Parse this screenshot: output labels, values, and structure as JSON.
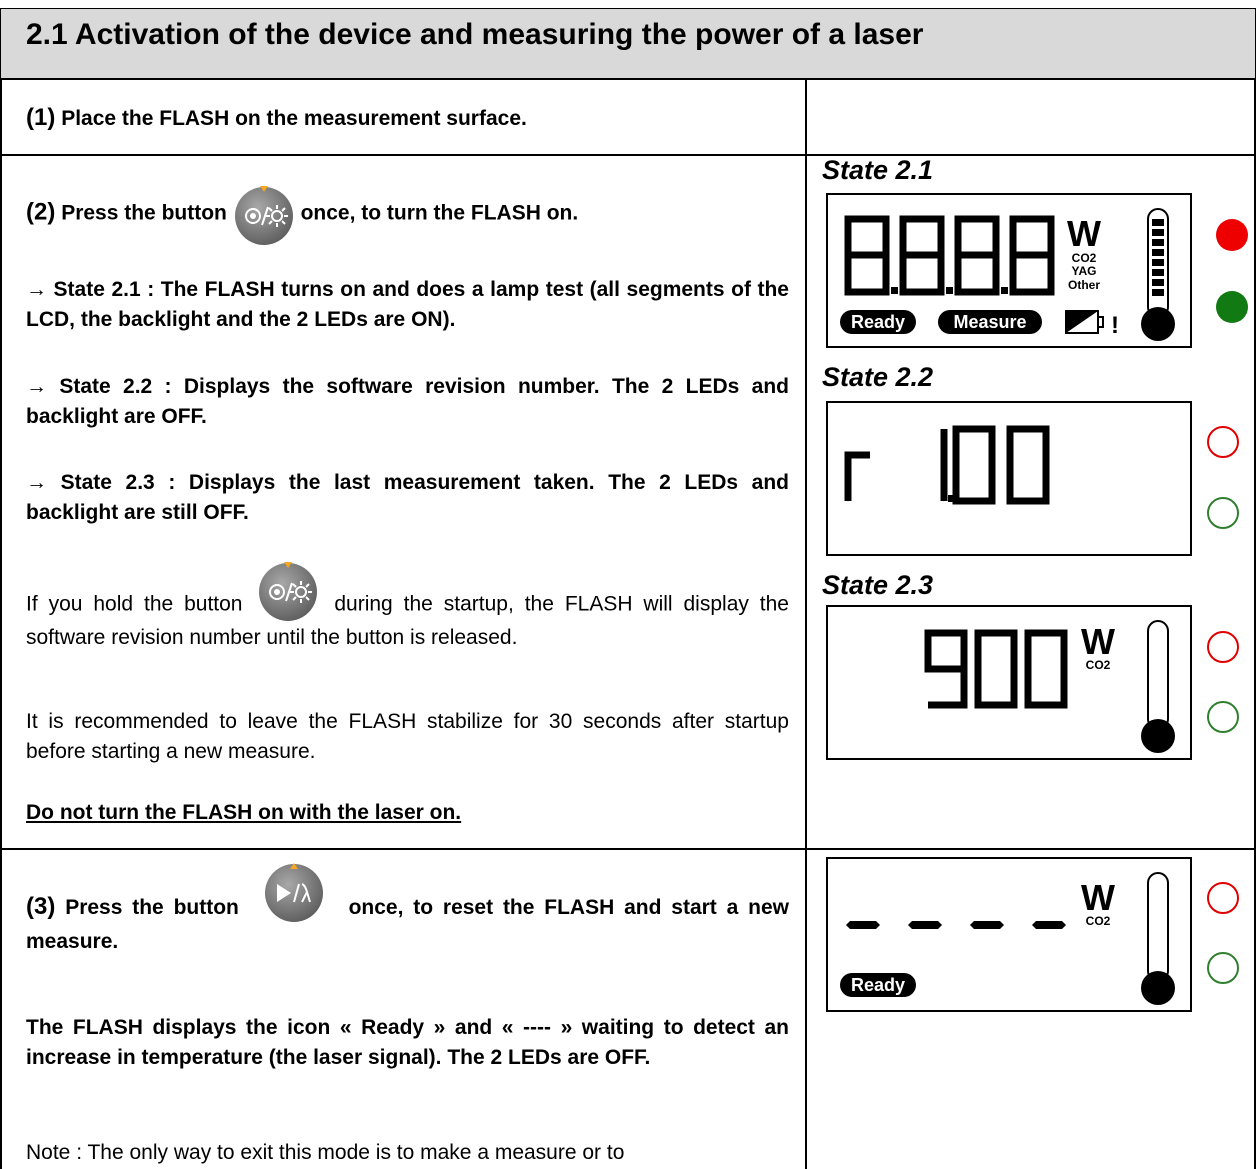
{
  "section": {
    "title": "2.1  Activation of the device and measuring the power of a laser"
  },
  "step1": {
    "number": "(1)",
    "text": "Place the FLASH on the measurement surface."
  },
  "step2": {
    "number": "(2)",
    "text_before": "Press the button",
    "text_after": "once, to turn the FLASH on.",
    "button_icon": "power-light-button-icon",
    "state21": "→ State 2.1 : The FLASH turns on and does a lamp test (all segments of the LCD, the backlight and the 2 LEDs are ON).",
    "state22": "→ State 2.2 : Displays the software revision number.  The 2 LEDs and backlight are OFF.",
    "state23": "→ State 2.3 : Displays the last measurement taken. The 2 LEDs and backlight are still OFF.",
    "hold_before": "If you hold the button",
    "hold_after": "during the startup, the FLASH will display the software revision number until the button is released.",
    "stabilize": "It is recommended to leave the FLASH stabilize for 30 seconds after startup before starting a new measure.",
    "warning": "Do not turn the FLASH on with the laser on."
  },
  "step3": {
    "number": "(3)",
    "text_before": "Press the button",
    "text_after": "once, to reset the FLASH and start a new measure.",
    "button_icon": "play-wavelength-button-icon",
    "ready_text": "The FLASH displays the icon « Ready » and « ---- » waiting to detect an increase in temperature (the laser signal).  The 2 LEDs are OFF.",
    "note": "Note : The only way to exit this mode is to make a measure or to"
  },
  "states": [
    {
      "label": "State 2.1",
      "digits": "8.8.8.8",
      "unit": "W",
      "laser_types": [
        "CO2",
        "YAG",
        "Other"
      ],
      "badges": [
        "Ready",
        "Measure"
      ],
      "warning_mark": "!",
      "leds": {
        "red": "on",
        "green": "on"
      }
    },
    {
      "label": "State 2.2",
      "digits": "r 1.00",
      "leds": {
        "red": "off",
        "green": "off"
      }
    },
    {
      "label": "State 2.3",
      "digits": "900",
      "unit": "W",
      "laser_type": "CO2",
      "leds": {
        "red": "off",
        "green": "off"
      }
    },
    {
      "label": "",
      "digits": "----",
      "unit": "W",
      "laser_type": "CO2",
      "badges": [
        "Ready"
      ],
      "leds": {
        "red": "off",
        "green": "off"
      }
    }
  ],
  "colors": {
    "title_bg": "#d9d9d9",
    "button_grey": "#7a7a7a",
    "arrow_orange": "#f5a623",
    "led_red": "#ee0000",
    "led_green": "#127a12"
  }
}
